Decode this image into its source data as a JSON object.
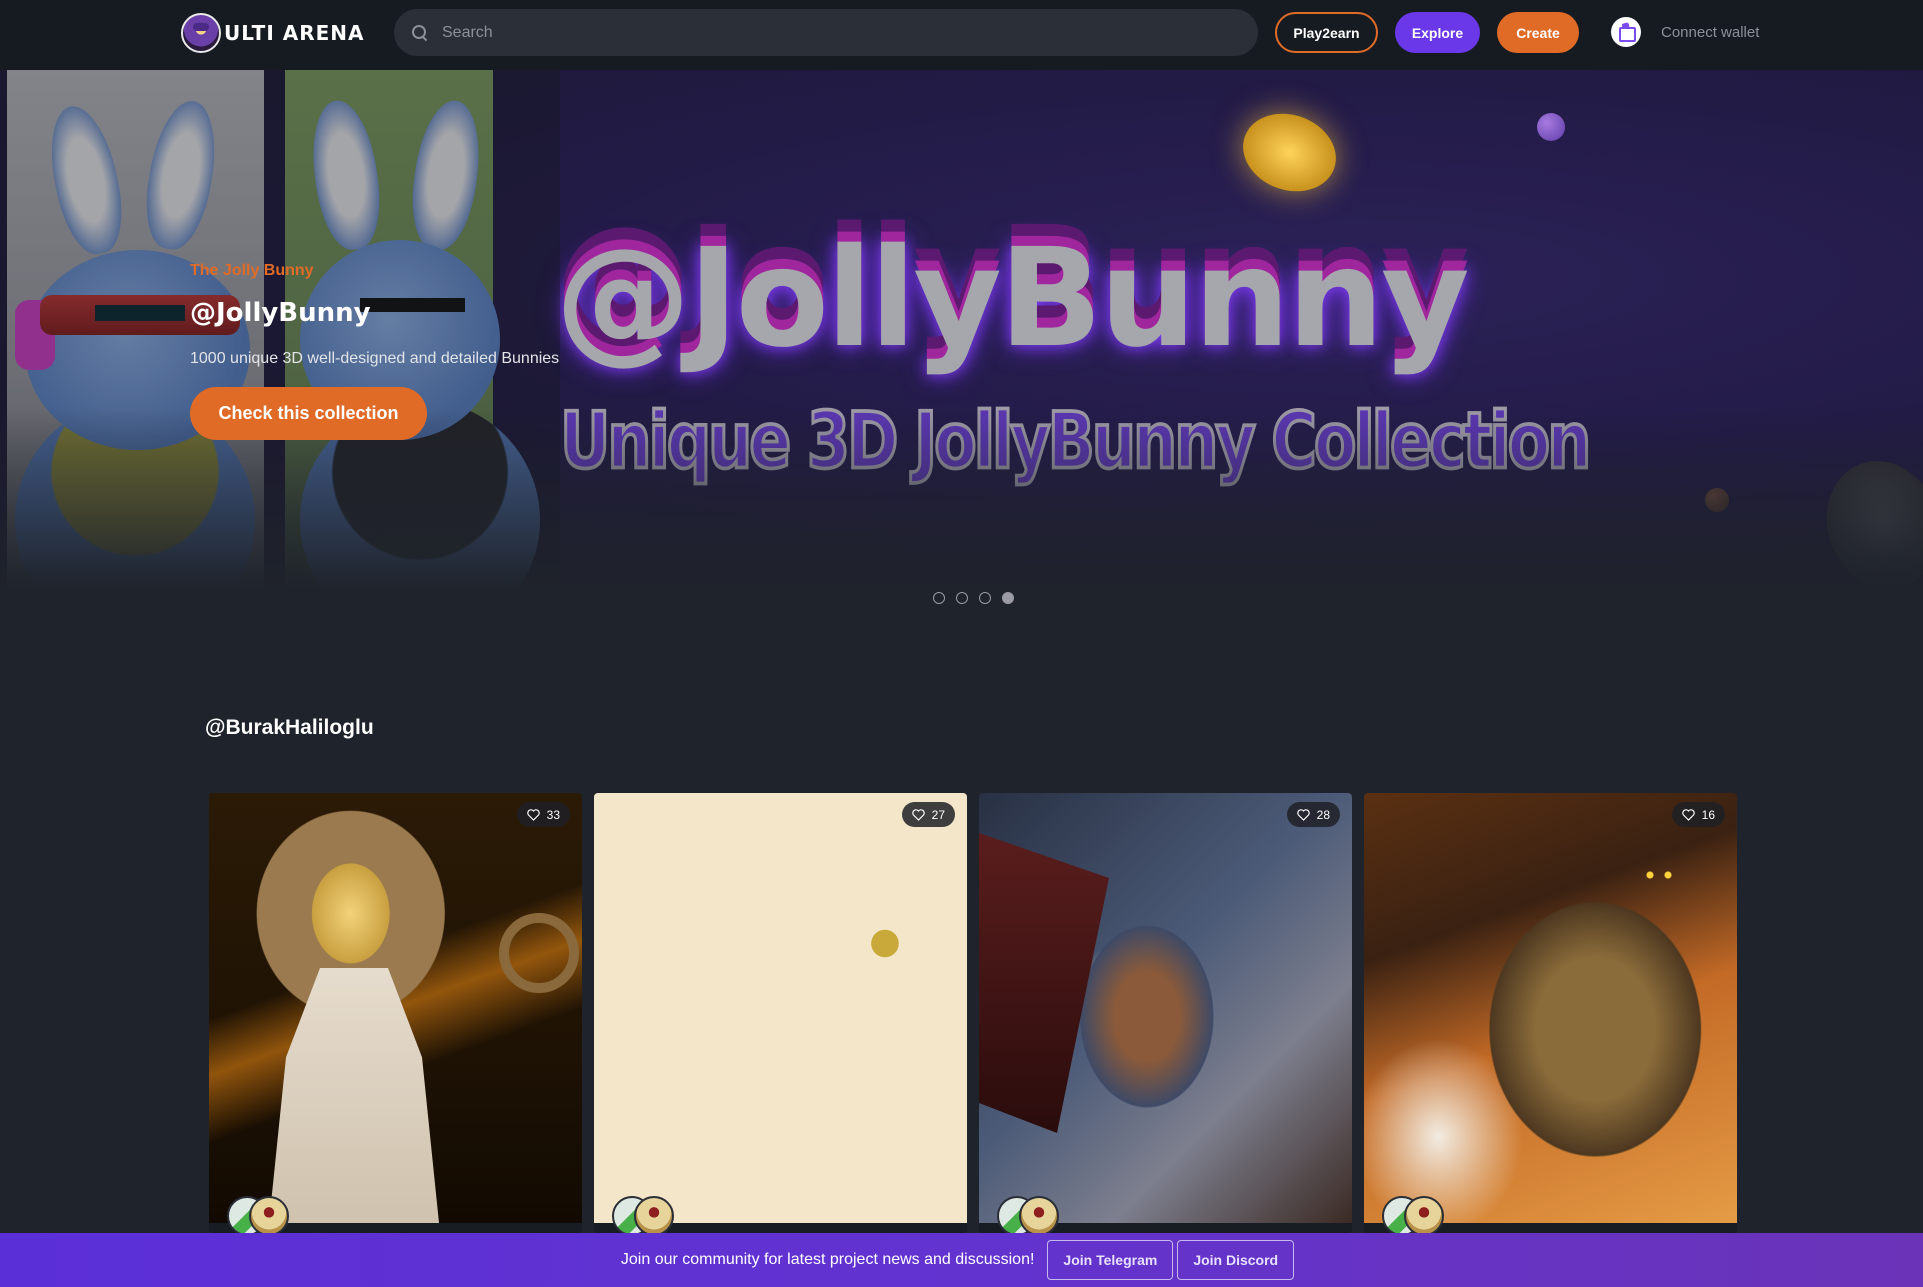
{
  "nav": {
    "brand": "ULTI ARENA",
    "search": {
      "placeholder": "Search",
      "value": ""
    },
    "buttons": {
      "play2earn": "Play2earn",
      "explore": "Explore",
      "create": "Create"
    },
    "wallet_label": "Connect wallet",
    "colors": {
      "accent_orange": "#e06b27",
      "accent_purple": "#6a38e8",
      "nav_bg": "#161b22"
    }
  },
  "hero": {
    "caption": "The Jolly Bunny",
    "title": "@JollyBunny",
    "description": "1000 unique 3D well-designed and detailed Bunnies",
    "cta": "Check this collection",
    "banner_art_title": "@JollyBunny",
    "banner_art_subtitle": "Unique 3D  JollyBunny Collection",
    "slides": {
      "count": 4,
      "active_index": 3
    }
  },
  "section": {
    "title": "@BurakHaliloglu",
    "cards": [
      {
        "likes": "33",
        "art": "golden-priestess"
      },
      {
        "likes": "27",
        "art": "golden-eye-face"
      },
      {
        "likes": "28",
        "art": "dragon-knight"
      },
      {
        "likes": "16",
        "art": "armored-warrior"
      }
    ]
  },
  "community": {
    "text": "Join our community for latest project news and discussion!",
    "telegram": "Join Telegram",
    "discord": "Join Discord"
  }
}
